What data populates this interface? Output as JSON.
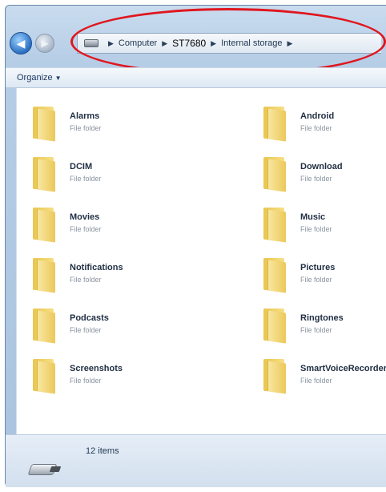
{
  "address_bar": {
    "breadcrumbs": [
      "Computer",
      "ST7680",
      "Internal storage"
    ]
  },
  "toolbar": {
    "organize_label": "Organize"
  },
  "folders": [
    {
      "name": "Alarms",
      "type": "File folder"
    },
    {
      "name": "Android",
      "type": "File folder"
    },
    {
      "name": "DCIM",
      "type": "File folder"
    },
    {
      "name": "Download",
      "type": "File folder"
    },
    {
      "name": "Movies",
      "type": "File folder"
    },
    {
      "name": "Music",
      "type": "File folder"
    },
    {
      "name": "Notifications",
      "type": "File folder"
    },
    {
      "name": "Pictures",
      "type": "File folder"
    },
    {
      "name": "Podcasts",
      "type": "File folder"
    },
    {
      "name": "Ringtones",
      "type": "File folder"
    },
    {
      "name": "Screenshots",
      "type": "File folder"
    },
    {
      "name": "SmartVoiceRecorder",
      "type": "File folder"
    }
  ],
  "status_bar": {
    "item_count": "12 items"
  },
  "colors": {
    "annotation": "#e0161e",
    "window_frame": "#b6cde6",
    "folder": "#f0d266"
  },
  "icons": {
    "back": "back-arrow-icon",
    "forward": "forward-arrow-icon",
    "drive": "drive-icon",
    "folder": "folder-icon",
    "device": "usb-drive-icon"
  }
}
